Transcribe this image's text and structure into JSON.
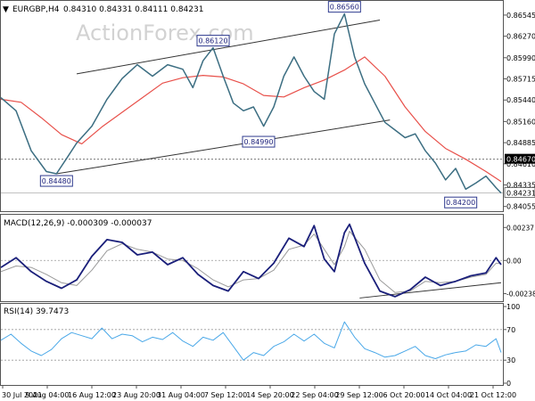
{
  "header": {
    "arrow": "▼",
    "symbol": "EURGBP,H4",
    "ohlc": "0.84310 0.84331 0.84111 0.84231"
  },
  "watermark": "ActionForex.com",
  "colors": {
    "price": "#3c6e82",
    "ma": "#e8504a",
    "macd": "#1a1f7a",
    "signal": "#9a9a9a",
    "rsi": "#4aa8e8",
    "line": "#333333",
    "label_border": "#2f3b8f"
  },
  "chart_data": [
    {
      "type": "line",
      "pane": "price",
      "title": "EURGBP,H4",
      "ylim": [
        0.8404,
        0.8666
      ],
      "y_ticks": [
        "0.86545",
        "0.86270",
        "0.85990",
        "0.85715",
        "0.85440",
        "0.85160",
        "0.84885",
        "0.84610",
        "0.84335",
        "0.84055"
      ],
      "current_price": "0.84231",
      "reference_level": "0.84670",
      "x_ticks": [
        "30 Jul 2021",
        "9 Aug 04:00",
        "16 Aug 12:00",
        "23 Aug 20:00",
        "31 Aug 04:00",
        "7 Sep 12:00",
        "14 Sep 20:00",
        "22 Sep 04:00",
        "29 Sep 12:00",
        "6 Oct 20:00",
        "14 Oct 04:00",
        "21 Oct 12:00"
      ],
      "n_bars": 100,
      "series": [
        {
          "role": "price",
          "x": [
            0,
            3,
            6,
            9,
            11,
            13,
            15,
            18,
            21,
            24,
            27,
            30,
            33,
            36,
            38,
            40,
            42,
            44,
            46,
            48,
            50,
            52,
            54,
            56,
            58,
            60,
            62,
            64,
            66,
            68,
            70,
            72,
            74,
            76,
            78,
            80,
            82,
            84,
            86,
            88,
            90,
            92,
            94,
            96,
            98,
            99
          ],
          "values": [
            0.8547,
            0.853,
            0.8478,
            0.8451,
            0.8448,
            0.8468,
            0.8488,
            0.851,
            0.8545,
            0.8572,
            0.859,
            0.8575,
            0.859,
            0.8584,
            0.856,
            0.8595,
            0.8612,
            0.8575,
            0.854,
            0.853,
            0.8535,
            0.851,
            0.8535,
            0.8575,
            0.86,
            0.8575,
            0.8555,
            0.8545,
            0.863,
            0.8656,
            0.86,
            0.8565,
            0.854,
            0.8515,
            0.8505,
            0.8495,
            0.85,
            0.8478,
            0.8462,
            0.844,
            0.8455,
            0.8428,
            0.8436,
            0.8445,
            0.843,
            0.8423
          ]
        },
        {
          "role": "moving-average",
          "x": [
            0,
            4,
            8,
            12,
            16,
            20,
            24,
            28,
            32,
            36,
            40,
            44,
            48,
            52,
            56,
            60,
            64,
            68,
            72,
            76,
            80,
            84,
            88,
            92,
            96,
            99
          ],
          "values": [
            0.8545,
            0.8541,
            0.8521,
            0.8499,
            0.8487,
            0.8509,
            0.8528,
            0.8547,
            0.8566,
            0.8573,
            0.8576,
            0.8574,
            0.8565,
            0.855,
            0.8548,
            0.856,
            0.857,
            0.8583,
            0.86,
            0.8575,
            0.8535,
            0.8503,
            0.8481,
            0.8467,
            0.8451,
            0.8438
          ]
        }
      ],
      "labels": [
        {
          "text": "0.84480",
          "x": 11,
          "y": 0.8448
        },
        {
          "text": "0.86120",
          "x": 42,
          "y": 0.8612
        },
        {
          "text": "0.84990",
          "x": 51,
          "y": 0.8499
        },
        {
          "text": "0.86560",
          "x": 68,
          "y": 0.8656
        },
        {
          "text": "0.84200",
          "x": 91,
          "y": 0.842
        }
      ],
      "trendlines": [
        {
          "x": [
            15,
            75
          ],
          "values": [
            0.8578,
            0.8648
          ]
        },
        {
          "x": [
            11,
            77
          ],
          "values": [
            0.8448,
            0.8518
          ]
        }
      ]
    },
    {
      "type": "line",
      "pane": "macd",
      "title": "MACD(12,26,9) -0.000309 -0.000037",
      "ylim": [
        -0.0028,
        0.0029
      ],
      "y_ticks": [
        "0.00237",
        "0.00",
        "-0.002387"
      ],
      "x": [
        0,
        3,
        6,
        9,
        12,
        15,
        18,
        21,
        24,
        27,
        30,
        33,
        36,
        39,
        42,
        45,
        48,
        51,
        54,
        57,
        60,
        62,
        64,
        66,
        68,
        69,
        72,
        75,
        78,
        81,
        84,
        87,
        90,
        93,
        96,
        98,
        99
      ],
      "series": [
        {
          "name": "MACD",
          "values": [
            -0.0005,
            0.0002,
            -0.0008,
            -0.0015,
            -0.002,
            -0.0014,
            0.0003,
            0.0015,
            0.0013,
            0.0004,
            0.0006,
            -0.0003,
            0.0002,
            -0.001,
            -0.0018,
            -0.0022,
            -0.0008,
            -0.0013,
            -0.0002,
            0.0016,
            0.001,
            0.0025,
            0.0001,
            -0.0008,
            0.002,
            0.0026,
            -0.0002,
            -0.0022,
            -0.0026,
            -0.0021,
            -0.0012,
            -0.0018,
            -0.0015,
            -0.0011,
            -0.0009,
            0.0002,
            -0.0003
          ]
        },
        {
          "name": "Signal",
          "values": [
            -0.0008,
            -0.0004,
            -0.0005,
            -0.001,
            -0.0016,
            -0.0018,
            -0.0007,
            0.0007,
            0.0012,
            0.0008,
            0.0006,
            0.0001,
            0.0,
            -0.0006,
            -0.0014,
            -0.0019,
            -0.0014,
            -0.0013,
            -0.0007,
            0.0008,
            0.0011,
            0.0019,
            0.0008,
            -0.0003,
            0.001,
            0.0021,
            0.0008,
            -0.0014,
            -0.0023,
            -0.0022,
            -0.0015,
            -0.0016,
            -0.0015,
            -0.0012,
            -0.001,
            -0.0002,
            -0.0002
          ]
        }
      ],
      "trendline": {
        "x": [
          71,
          99
        ],
        "values": [
          -0.0027,
          -0.0016
        ]
      }
    },
    {
      "type": "line",
      "pane": "rsi",
      "title": "RSI(14) 39.7473",
      "ylim": [
        0,
        100
      ],
      "y_ticks": [
        "100",
        "70",
        "30",
        "0"
      ],
      "levels": [
        70,
        30
      ],
      "x": [
        0,
        2,
        4,
        6,
        8,
        10,
        12,
        14,
        16,
        18,
        20,
        22,
        24,
        26,
        28,
        30,
        32,
        34,
        36,
        38,
        40,
        42,
        44,
        46,
        48,
        50,
        52,
        54,
        56,
        58,
        60,
        62,
        64,
        66,
        68,
        70,
        72,
        74,
        76,
        78,
        80,
        82,
        84,
        86,
        88,
        90,
        92,
        94,
        96,
        98,
        99
      ],
      "values": [
        56,
        64,
        52,
        42,
        36,
        44,
        58,
        66,
        62,
        58,
        72,
        58,
        64,
        62,
        54,
        60,
        57,
        66,
        55,
        48,
        60,
        56,
        66,
        48,
        30,
        40,
        36,
        48,
        54,
        64,
        55,
        64,
        52,
        46,
        80,
        60,
        45,
        40,
        34,
        36,
        42,
        48,
        36,
        32,
        37,
        40,
        42,
        50,
        48,
        58,
        40
      ]
    }
  ]
}
